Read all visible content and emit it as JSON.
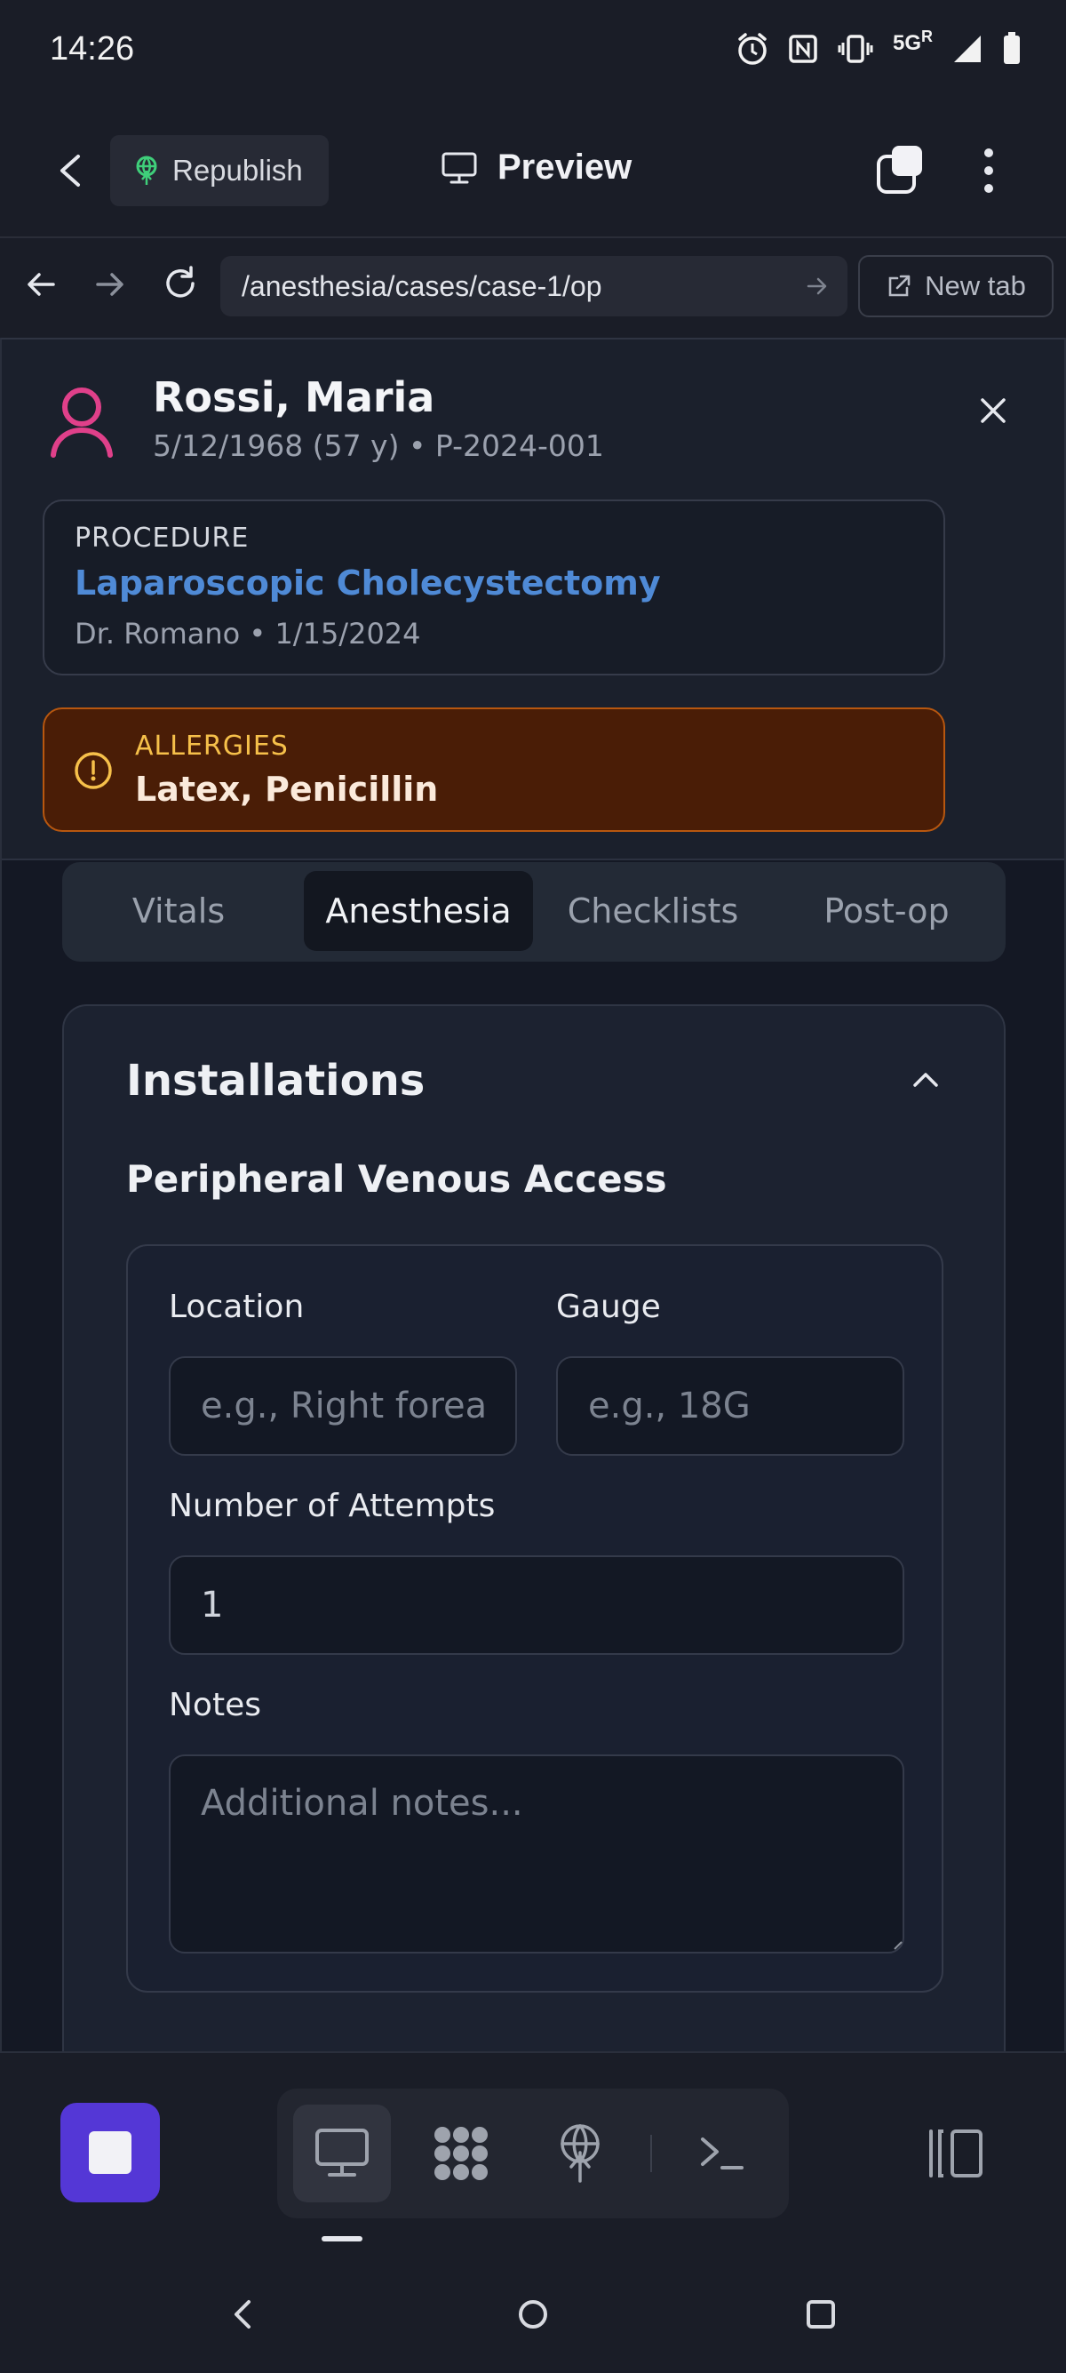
{
  "status_bar": {
    "time": "14:26",
    "network": "5G",
    "network_sup": "R",
    "icons": [
      "alarm-icon",
      "nfc-icon",
      "vibrate-icon",
      "signal-icon",
      "battery-icon"
    ]
  },
  "toolbar": {
    "republish_label": "Republish",
    "preview_label": "Preview"
  },
  "browser": {
    "url": "/anesthesia/cases/case-1/op",
    "new_tab_label": "New tab"
  },
  "patient": {
    "name": "Rossi, Maria",
    "meta": "5/12/1968 (57 y) • P-2024-001"
  },
  "procedure": {
    "label": "PROCEDURE",
    "name": "Laparoscopic Cholecystectomy",
    "meta": "Dr. Romano • 1/15/2024"
  },
  "allergies": {
    "label": "ALLERGIES",
    "value": "Latex, Penicillin"
  },
  "tabs": [
    {
      "label": "Vitals",
      "active": false
    },
    {
      "label": "Anesthesia",
      "active": true
    },
    {
      "label": "Checklists",
      "active": false
    },
    {
      "label": "Post-op",
      "active": false
    }
  ],
  "installations": {
    "title": "Installations",
    "subtitle": "Peripheral Venous Access",
    "location_label": "Location",
    "location_placeholder": "e.g., Right forearm",
    "gauge_label": "Gauge",
    "gauge_placeholder": "e.g., 18G",
    "attempts_label": "Number of Attempts",
    "attempts_value": "1",
    "notes_label": "Notes",
    "notes_placeholder": "Additional notes..."
  },
  "colors": {
    "accent_purple": "#5437d6",
    "procedure_blue": "#4f8ad6",
    "allergy_bg": "#4a1d06",
    "allergy_border": "#b8570f",
    "allergy_label": "#f6c04a",
    "avatar_pink": "#e0408a"
  }
}
